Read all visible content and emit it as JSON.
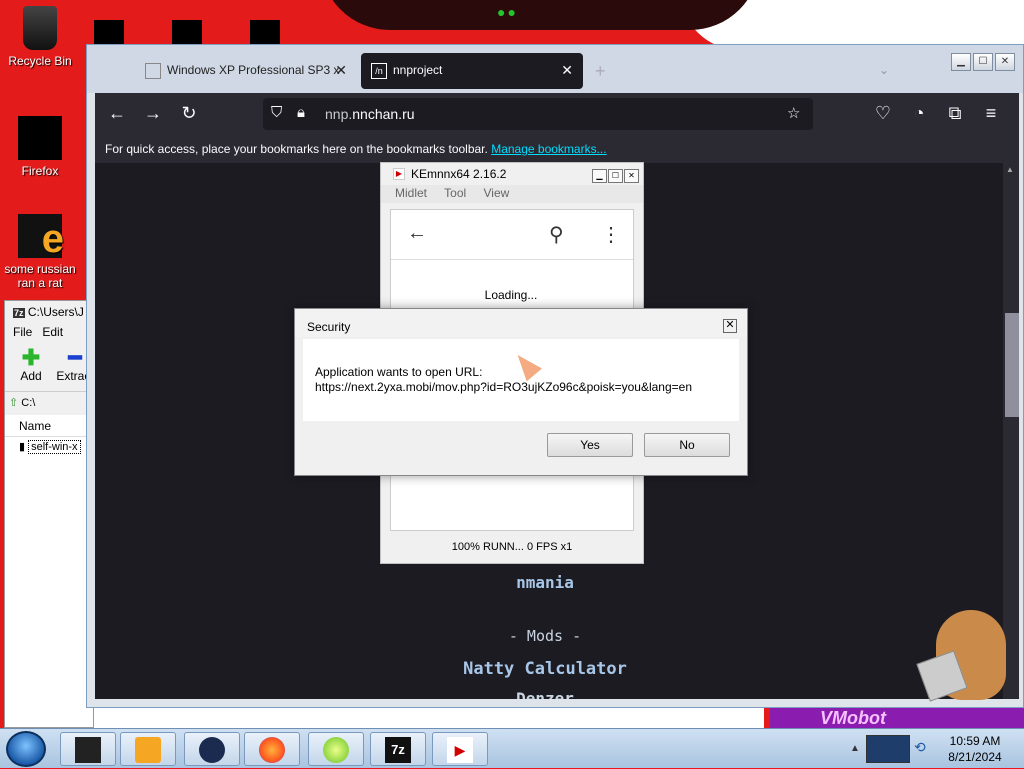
{
  "desktop": {
    "icons": [
      {
        "label": "Recycle Bin"
      },
      {
        "label": "Firefox"
      },
      {
        "label": "some russian ran a rat"
      }
    ]
  },
  "zip_window": {
    "title": "C:\\Users\\J",
    "menu": [
      "File",
      "Edit"
    ],
    "toolbar": [
      "Add",
      "Extract"
    ],
    "address": "C:\\",
    "column_name": "Name",
    "files": [
      "self-win-x"
    ]
  },
  "browser": {
    "tabs": [
      {
        "label": "Windows XP Professional SP3 x",
        "active": false
      },
      {
        "label": "nnproject",
        "active": true
      }
    ],
    "url_prefix": "nnp.",
    "url_domain": "nnchan.ru",
    "bookmark_hint": "For quick access, place your bookmarks here on the bookmarks toolbar.",
    "bookmark_link": "Manage bookmarks...",
    "page": {
      "items": [
        "nmania",
        "- Mods -",
        "Natty Calculator",
        "Denzer"
      ]
    }
  },
  "emulator": {
    "title": "KEmnnx64 2.16.2",
    "menu": [
      "Midlet",
      "Tool",
      "View"
    ],
    "loading": "Loading...",
    "status": "100% RUNN... 0 FPS x1"
  },
  "dialog": {
    "title": "Security",
    "message": "Application wants to open URL:",
    "url": "https://next.2yxa.mobi/mov.php?id=RO3ujKZo96c&poisk=you&lang=en",
    "yes": "Yes",
    "no": "No"
  },
  "wallpaper_text": "VMobot",
  "taskbar": {
    "time": "10:59 AM",
    "date": "8/21/2024"
  },
  "colors": {
    "desktop": "#e31b1b",
    "browser_dark": "#1c1b22",
    "link": "#00ddff"
  }
}
